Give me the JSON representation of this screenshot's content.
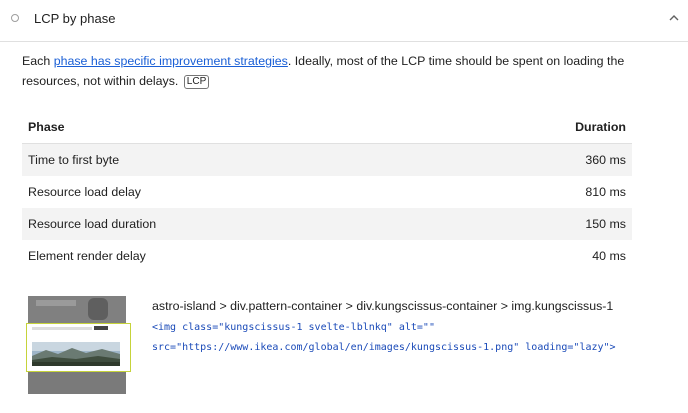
{
  "audit": {
    "title": "LCP by phase",
    "status_icon": "circle-outline-icon",
    "chevron_icon": "chevron-up-icon"
  },
  "description": {
    "prefix": "Each ",
    "link_text": "phase has specific improvement strategies",
    "suffix": ". Ideally, most of the LCP time should be spent on loading the resources, not within delays.",
    "badge": "LCP"
  },
  "table": {
    "headers": {
      "phase": "Phase",
      "duration": "Duration"
    },
    "rows": [
      {
        "phase": "Time to first byte",
        "duration": "360 ms"
      },
      {
        "phase": "Resource load delay",
        "duration": "810 ms"
      },
      {
        "phase": "Resource load duration",
        "duration": "150 ms"
      },
      {
        "phase": "Element render delay",
        "duration": "40 ms"
      }
    ]
  },
  "element": {
    "path": "astro-island > div.pattern-container > div.kungscissus-container > img.kungscissus-1",
    "snippet_line1": "<img class=\"kungscissus-1 svelte-lblnkq\" alt=\"\"",
    "snippet_line2": "src=\"https://www.ikea.com/global/en/images/kungscissus-1.png\" loading=\"lazy\">"
  },
  "colors": {
    "link": "#1a5fd6",
    "highlight": "#c6d33a",
    "code": "#1a4ab8"
  }
}
